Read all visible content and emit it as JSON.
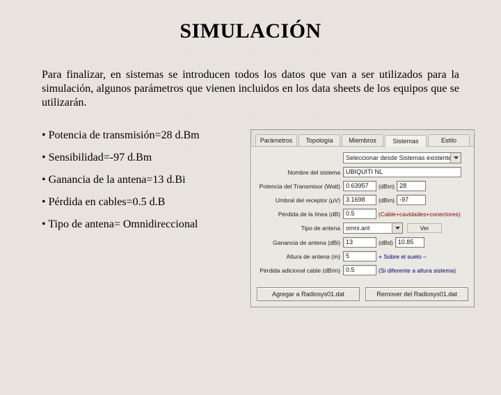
{
  "title": "SIMULACIÓN",
  "intro": "Para finalizar, en sistemas se introducen todos los datos que van a ser utilizados para la simulación, algunos parámetros que vienen incluidos en los data sheets de los equipos que se utilizarán.",
  "bullets": [
    "• Potencia de transmisión=28 d.Bm",
    "• Sensibilidad=-97 d.Bm",
    "• Ganancia de la antena=13 d.Bi",
    "• Pérdida en cables=0.5 d.B",
    "• Tipo de antena= Omnidireccional"
  ],
  "dlg": {
    "tabs": [
      "Parámetros",
      "Topología",
      "Miembros",
      "Sistemas",
      "Estilo"
    ],
    "active_tab": 3,
    "system_label": "Seleccionar desde Sistemas existentes",
    "name_label": "Nombre del sistema",
    "name_value": "UBIQUITI NL",
    "tx_label": "Potencia del Transmisor (Watt)",
    "tx_value": "0.63957",
    "tx_unit": "(dBm)",
    "tx_dbm": "28",
    "rx_label": "Umbral del receptor (µV)",
    "rx_value": "3.1698",
    "rx_unit": "(dBm)",
    "rx_dbm": "-97",
    "loss_label": "Pérdida de la línea (dB)",
    "loss_value": "0.5",
    "cable_label": "(Cable+cavidades+conectores)",
    "anttype_label": "Tipo de antena",
    "anttype_value": "omni.ant",
    "anttype_view": "Ver",
    "gain_label": "Ganancia de antena (dBi)",
    "gain_value": "13",
    "gain_unit": "(dBd)",
    "gain_dbd": "10.85",
    "h_label": "Altura de antena (m)",
    "h_value": "5",
    "h_misc": "+  Sobre el suelo  –",
    "addloss_label": "Pérdida adicional cable (dB/m)",
    "addloss_value": "0.5",
    "addloss_note": "(Si diferente a altura sistema)",
    "btn_add": "Agregar a Radiosys01.dat",
    "btn_del": "Remover del Radiosys01.dat"
  }
}
